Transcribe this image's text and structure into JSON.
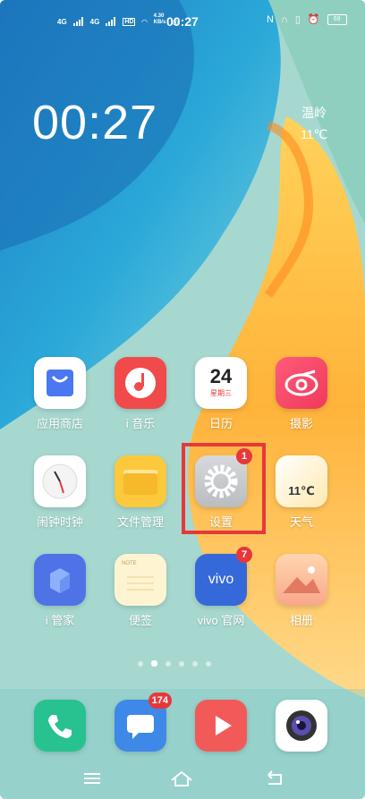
{
  "status_bar": {
    "net_label_1": "4G",
    "net_label_2": "4G",
    "hd_label": "HD",
    "speed_value": "4.30",
    "speed_unit": "KB/s",
    "time": "00:27",
    "battery_text": "69"
  },
  "lock_widget": {
    "clock": "00:27",
    "city": "温岭",
    "temperature": "11℃"
  },
  "apps": [
    {
      "label": "应用商店"
    },
    {
      "label": "i 音乐"
    },
    {
      "label": "日历",
      "day": "24",
      "weekday": "星期三"
    },
    {
      "label": "摄影"
    },
    {
      "label": "闹钟时钟"
    },
    {
      "label": "文件管理"
    },
    {
      "label": "设置",
      "badge": "1"
    },
    {
      "label": "天气",
      "temp": "11℃"
    },
    {
      "label": "i 管家"
    },
    {
      "label": "便签",
      "note_text": "NOTE"
    },
    {
      "label": "vivo 官网",
      "badge": "7",
      "logo_text": "vivo"
    },
    {
      "label": "相册"
    }
  ],
  "dock": [
    {
      "name": "phone"
    },
    {
      "name": "messages",
      "badge": "174"
    },
    {
      "name": "video"
    },
    {
      "name": "camera"
    }
  ],
  "pages": {
    "total": 6,
    "active": 1
  }
}
